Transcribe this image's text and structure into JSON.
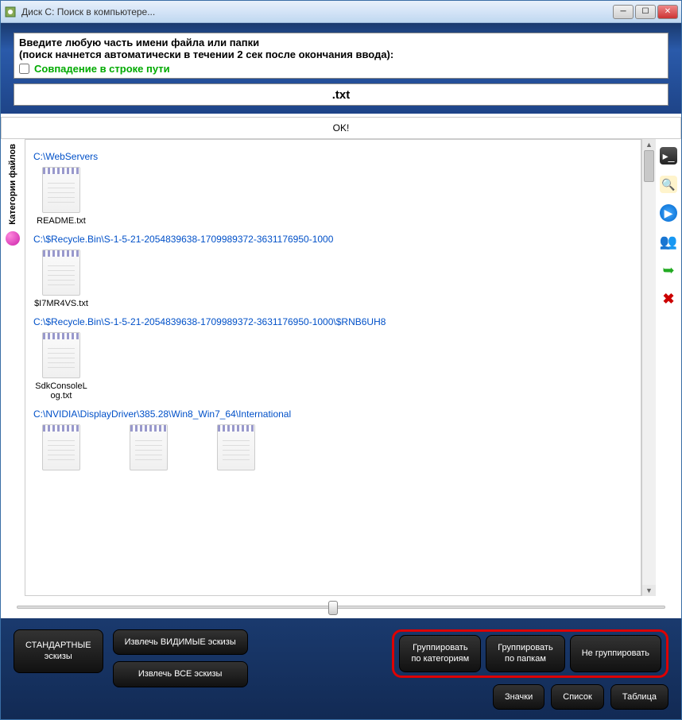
{
  "window": {
    "title": "Диск C: Поиск в компьютере..."
  },
  "header": {
    "instruction1": "Введите любую часть имени файла или папки",
    "instruction2": "(поиск начнется автоматически в течении 2 сек после окончания ввода):",
    "match_path_label": "Совпадение в строке пути",
    "search_value": ".txt"
  },
  "status": {
    "ok": "OK!"
  },
  "left_rail": {
    "label": "Категории файлов"
  },
  "groups": [
    {
      "path": "C:\\WebServers",
      "files": [
        {
          "name": "README.txt"
        }
      ]
    },
    {
      "path": "C:\\$Recycle.Bin\\S-1-5-21-2054839638-1709989372-3631176950-1000",
      "files": [
        {
          "name": "$I7MR4VS.txt"
        }
      ]
    },
    {
      "path": "C:\\$Recycle.Bin\\S-1-5-21-2054839638-1709989372-3631176950-1000\\$RNB6UH8",
      "files": [
        {
          "name": "SdkConsoleLog.txt"
        }
      ]
    },
    {
      "path": "C:\\NVIDIA\\DisplayDriver\\385.28\\Win8_Win7_64\\International",
      "files": [
        {
          "name": ""
        },
        {
          "name": ""
        },
        {
          "name": ""
        }
      ]
    }
  ],
  "footer": {
    "standard_sketches_l1": "СТАНДАРТНЫЕ",
    "standard_sketches_l2": "эскизы",
    "extract_visible": "Извлечь ВИДИМЫЕ эскизы",
    "extract_all": "Извлечь ВСЕ эскизы",
    "group_cat_l1": "Группировать",
    "group_cat_l2": "по категориям",
    "group_folder_l1": "Группировать",
    "group_folder_l2": "по папкам",
    "no_group": "Не группировать",
    "view_icons": "Значки",
    "view_list": "Список",
    "view_table": "Таблица"
  }
}
